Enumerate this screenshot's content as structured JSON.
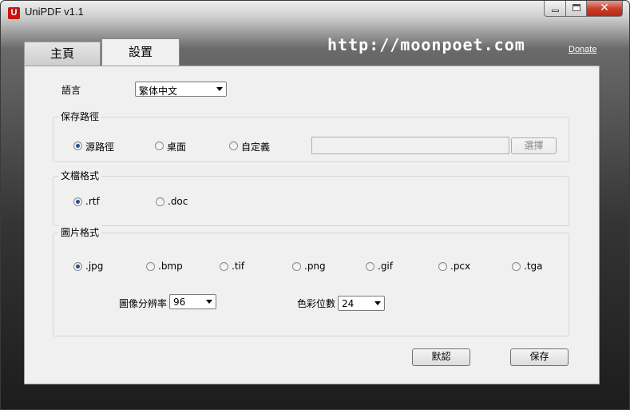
{
  "window": {
    "title": "UniPDF v1.1",
    "close_glyph": "✕"
  },
  "tabs": [
    {
      "label": "主頁"
    },
    {
      "label": "設置"
    }
  ],
  "header": {
    "website": "http://moonpoet.com",
    "donate": "Donate"
  },
  "language": {
    "label": "語言",
    "value": "繁体中文"
  },
  "save_path": {
    "title": "保存路徑",
    "options": [
      "源路徑",
      "桌面",
      "自定義"
    ],
    "selected": 0,
    "custom_path": "",
    "browse_label": "選擇"
  },
  "doc_format": {
    "title": "文檔格式",
    "options": [
      ".rtf",
      ".doc"
    ],
    "selected": 0
  },
  "image_format": {
    "title": "圖片格式",
    "options": [
      ".jpg",
      ".bmp",
      ".tif",
      ".png",
      ".gif",
      ".pcx",
      ".tga"
    ],
    "selected": 0,
    "resolution_label": "圖像分辨率",
    "resolution_value": "96",
    "color_depth_label": "色彩位數",
    "color_depth_value": "24"
  },
  "actions": {
    "default_label": "默認",
    "save_label": "保存"
  }
}
